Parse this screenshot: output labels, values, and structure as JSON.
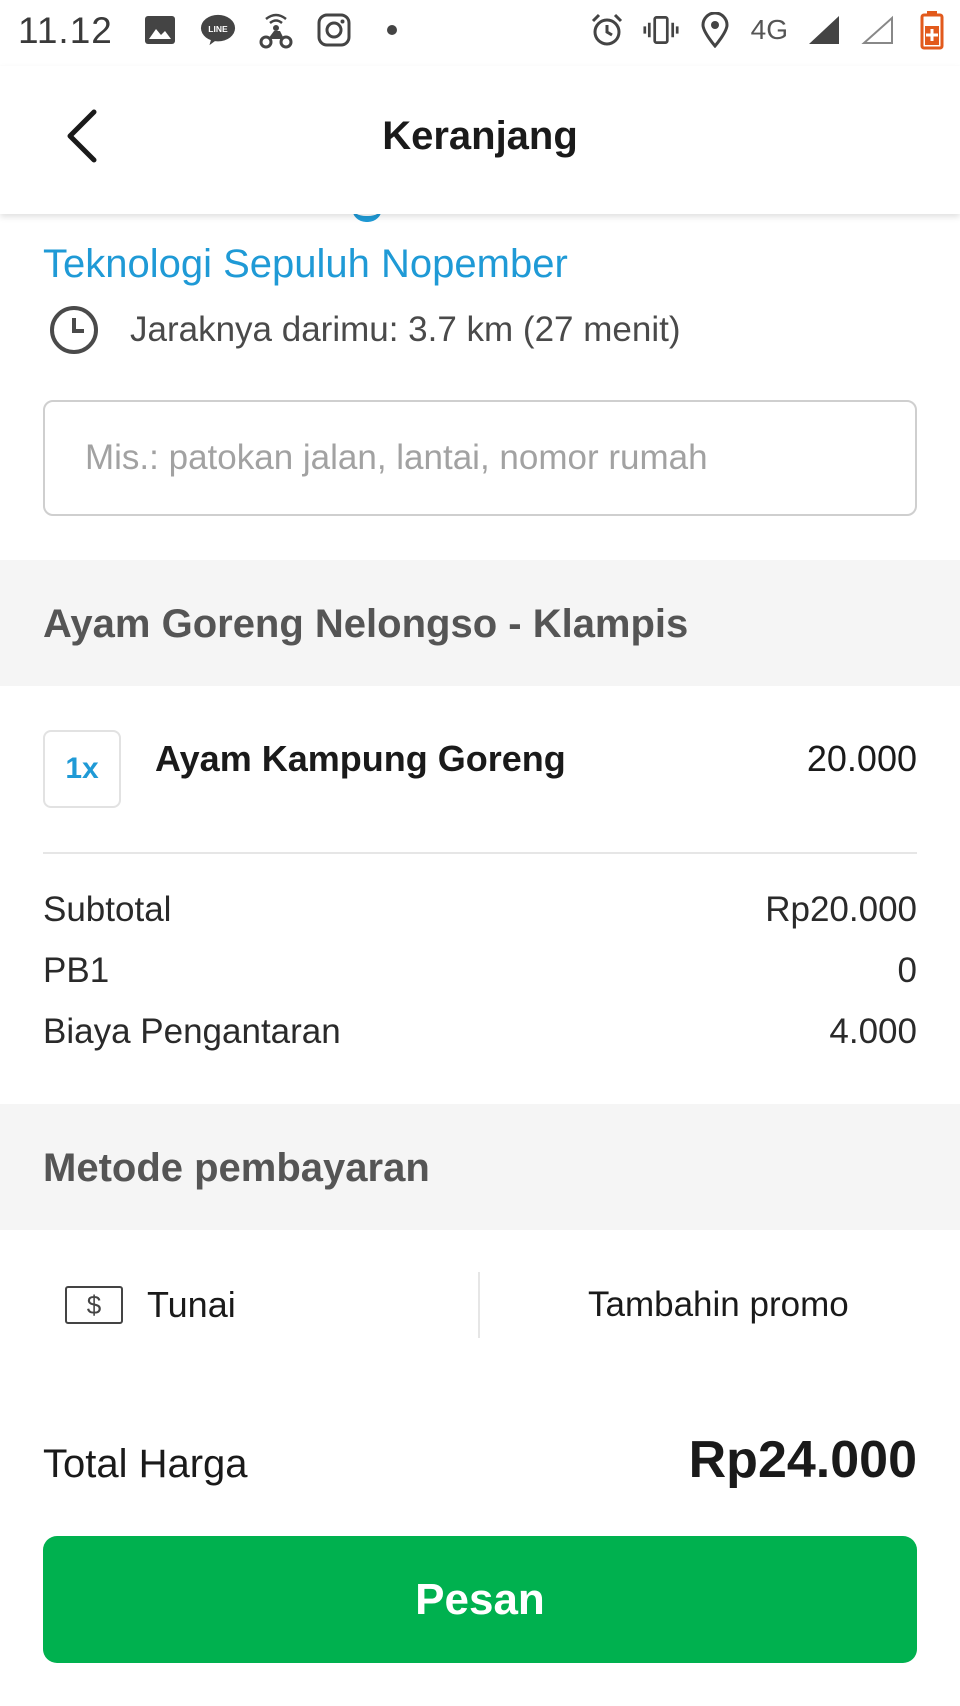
{
  "status_bar": {
    "time": "11.12",
    "network": "4G",
    "left_icons": [
      "gallery-icon",
      "line-icon",
      "scooter-icon",
      "instagram-icon",
      "dot-icon"
    ],
    "right_icons": [
      "alarm-icon",
      "vibrate-icon",
      "location-icon",
      "signal-icon",
      "signal-empty-icon",
      "battery-icon"
    ]
  },
  "header": {
    "title": "Keranjang"
  },
  "delivery": {
    "address_line": "Teknologi Sepuluh Nopember",
    "distance_text": "Jaraknya darimu: 3.7 km (27 menit)",
    "note_placeholder": "Mis.: patokan jalan, lantai, nomor rumah",
    "note_value": ""
  },
  "restaurant": {
    "name": "Ayam Goreng Nelongso - Klampis"
  },
  "items": [
    {
      "qty": "1x",
      "name": "Ayam Kampung Goreng",
      "price": "20.000"
    }
  ],
  "fees": [
    {
      "label": "Subtotal",
      "value": "Rp20.000"
    },
    {
      "label": "PB1",
      "value": "0"
    },
    {
      "label": "Biaya Pengantaran",
      "value": "4.000"
    }
  ],
  "payment": {
    "section_title": "Metode pembayaran",
    "cash_symbol": "$",
    "method_label": "Tunai",
    "promo_label": "Tambahin promo"
  },
  "total": {
    "label": "Total Harga",
    "value": "Rp24.000"
  },
  "order_button": {
    "label": "Pesan"
  },
  "colors": {
    "accent_blue": "#1f9ad6",
    "primary_green": "#00b14f",
    "section_bg": "#f5f5f5"
  }
}
